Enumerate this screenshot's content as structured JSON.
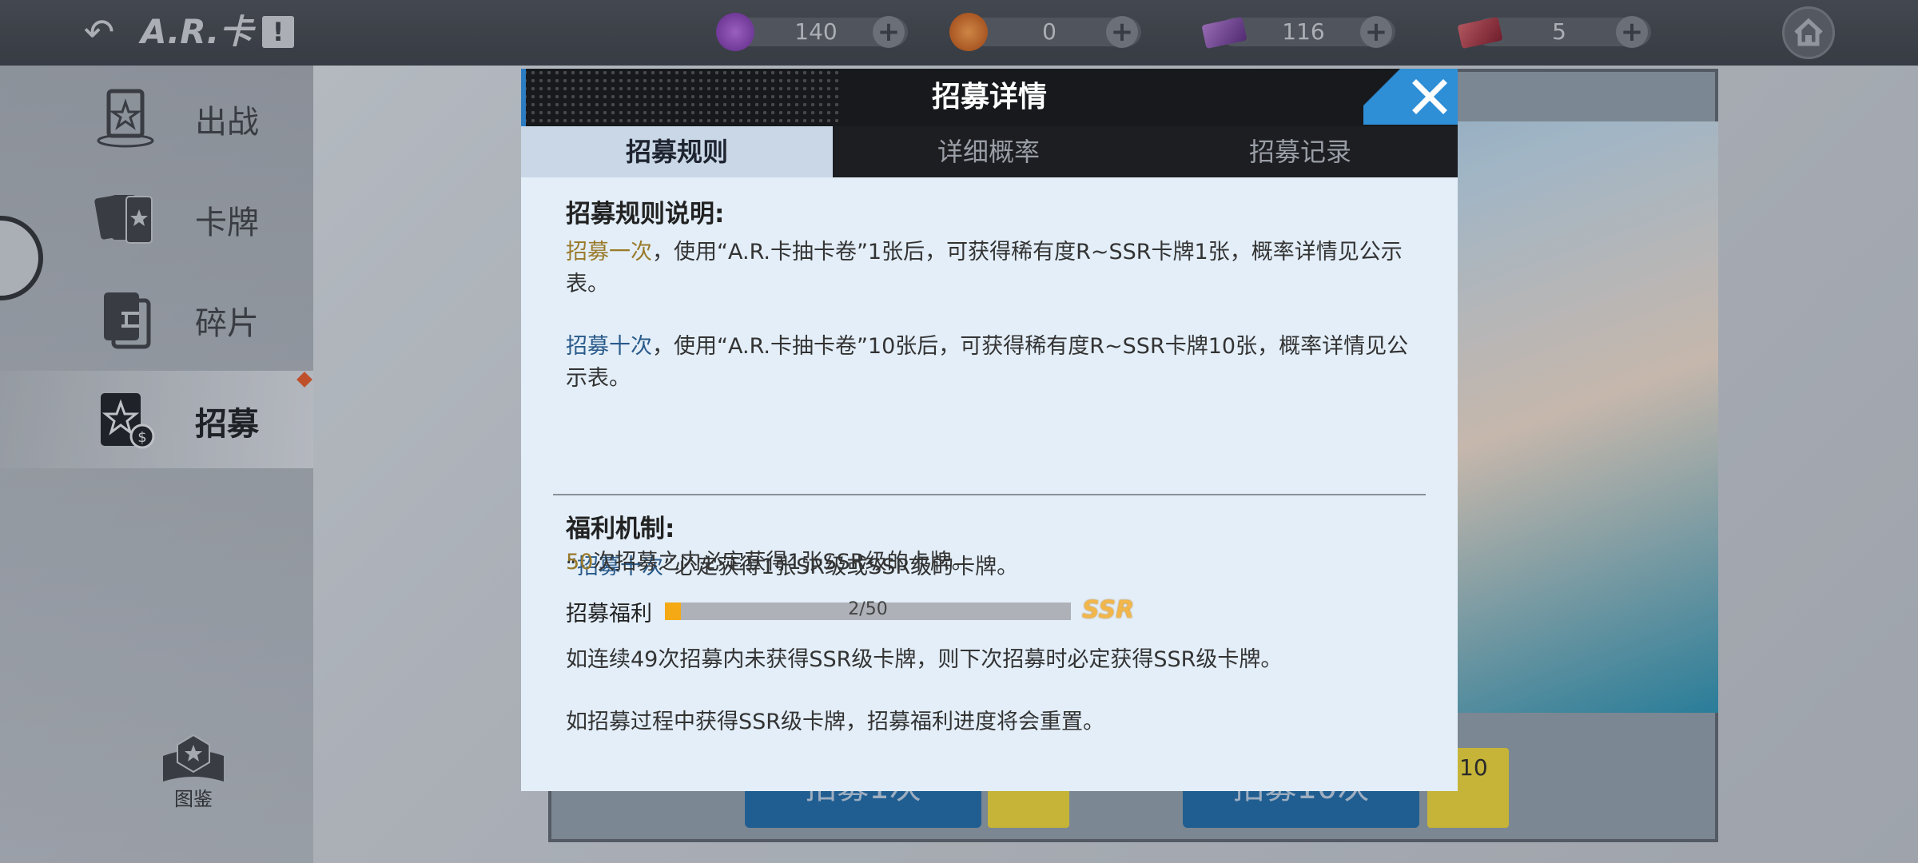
{
  "topbar": {
    "title": "A.R.卡",
    "info_label": "!",
    "resources": [
      {
        "name": "purple-coin",
        "value": "140",
        "color": "#8a3fb8"
      },
      {
        "name": "orange-coin",
        "value": "0",
        "color": "#d66a1c"
      },
      {
        "name": "purple-ticket",
        "value": "116",
        "color": "#7a3fa0"
      },
      {
        "name": "red-ticket",
        "value": "5",
        "color": "#b02a3a"
      }
    ],
    "plus_label": "+"
  },
  "sidebar": {
    "items": [
      {
        "label": "出战"
      },
      {
        "label": "卡牌"
      },
      {
        "label": "碎片"
      },
      {
        "label": "招募"
      }
    ],
    "codex_label": "图鉴"
  },
  "banner": {
    "pull_once_label": "招募1次",
    "pull_ten_label": "招募10次",
    "ten_ticket_count": "10"
  },
  "dialog": {
    "title": "招募详情",
    "tabs": [
      {
        "label": "招募规则"
      },
      {
        "label": "详细概率"
      },
      {
        "label": "招募记录"
      }
    ],
    "rules": {
      "heading": "招募规则说明:",
      "once_key": "招募一次",
      "once_text": "，使用“A.R.卡抽卡卷”1张后，可获得稀有度R~SSR卡牌1张，概率详情见公示表。",
      "ten_key": "招募十次",
      "ten_text": "，使用“A.R.卡抽卡卷”10张后，可获得稀有度R~SSR卡牌10张，概率详情见公示表。"
    },
    "welfare": {
      "heading": "福利机制:",
      "ten_quote_open": "“",
      "ten_key": "招募十次",
      "ten_text": "”必定获得1张SR级或SSR级的卡牌。",
      "fifty_key": "50",
      "fifty_text": "次招募之内必定获得1张SSR级的卡牌。",
      "progress_label": "招募福利",
      "progress_text": "2/50",
      "progress_value": 0.04,
      "ssr_label": "SSR",
      "pity_text": "如连续49次招募内未获得SSR级卡牌，则下次招募时必定获得SSR级卡牌。",
      "reset_text": "如招募过程中获得SSR级卡牌，招募福利进度将会重置。"
    }
  },
  "colors": {
    "accent_blue": "#2e8ed6",
    "progress": "#f4a915"
  }
}
